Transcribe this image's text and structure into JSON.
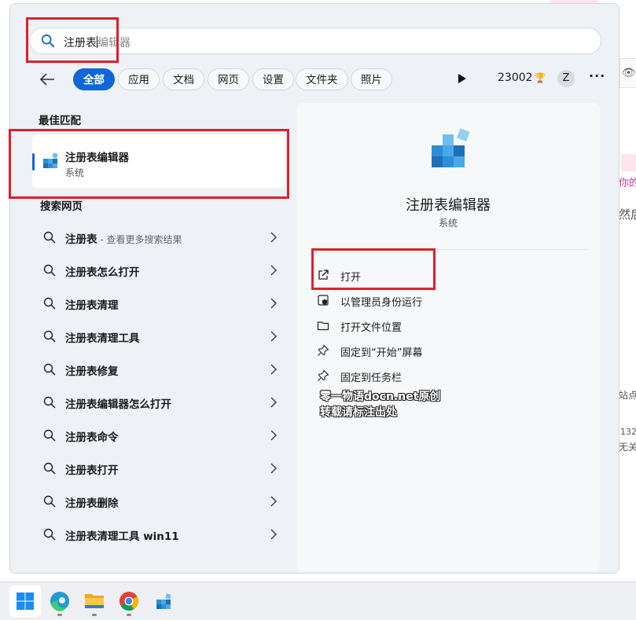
{
  "background_page": {
    "lines": [
      "你的",
      "然后",
      "站点",
      "132",
      "无关"
    ]
  },
  "search": {
    "typed": "注册表",
    "suggestion_rest": "编辑器"
  },
  "filters": {
    "items": [
      "全部",
      "应用",
      "文档",
      "网页",
      "设置",
      "文件夹",
      "照片"
    ],
    "active_index": 0,
    "points": "23002",
    "avatar_letter": "Z",
    "more": "···"
  },
  "best_match": {
    "title": "最佳匹配",
    "name": "注册表编辑器",
    "type": "系统"
  },
  "web_search": {
    "title": "搜索网页",
    "items": [
      {
        "text": "注册表",
        "sub": " - 查看更多搜索结果"
      },
      {
        "text": "注册表怎么打开",
        "sub": ""
      },
      {
        "text": "注册表清理",
        "sub": ""
      },
      {
        "text": "注册表清理工具",
        "sub": ""
      },
      {
        "text": "注册表修复",
        "sub": ""
      },
      {
        "text": "注册表编辑器怎么打开",
        "sub": ""
      },
      {
        "text": "注册表命令",
        "sub": ""
      },
      {
        "text": "注册表打开",
        "sub": ""
      },
      {
        "text": "注册表删除",
        "sub": ""
      },
      {
        "text": "注册表清理工具 win11",
        "sub": ""
      }
    ]
  },
  "detail": {
    "name": "注册表编辑器",
    "type": "系统",
    "actions": [
      {
        "label": "打开",
        "icon": "open-external-icon"
      },
      {
        "label": "以管理员身份运行",
        "icon": "admin-shield-icon"
      },
      {
        "label": "打开文件位置",
        "icon": "folder-icon"
      },
      {
        "label": "固定到“开始”屏幕",
        "icon": "pin-icon"
      },
      {
        "label": "固定到任务栏",
        "icon": "pin-icon"
      }
    ],
    "watermark": [
      "零一物语docn.net原创",
      "转载请标注出处"
    ]
  },
  "taskbar": {
    "apps": [
      "windows-start-icon",
      "edge-icon",
      "file-explorer-icon",
      "chrome-icon",
      "regedit-icon"
    ]
  },
  "colors": {
    "accent": "#1066d6",
    "annotation": "#e0202a"
  }
}
